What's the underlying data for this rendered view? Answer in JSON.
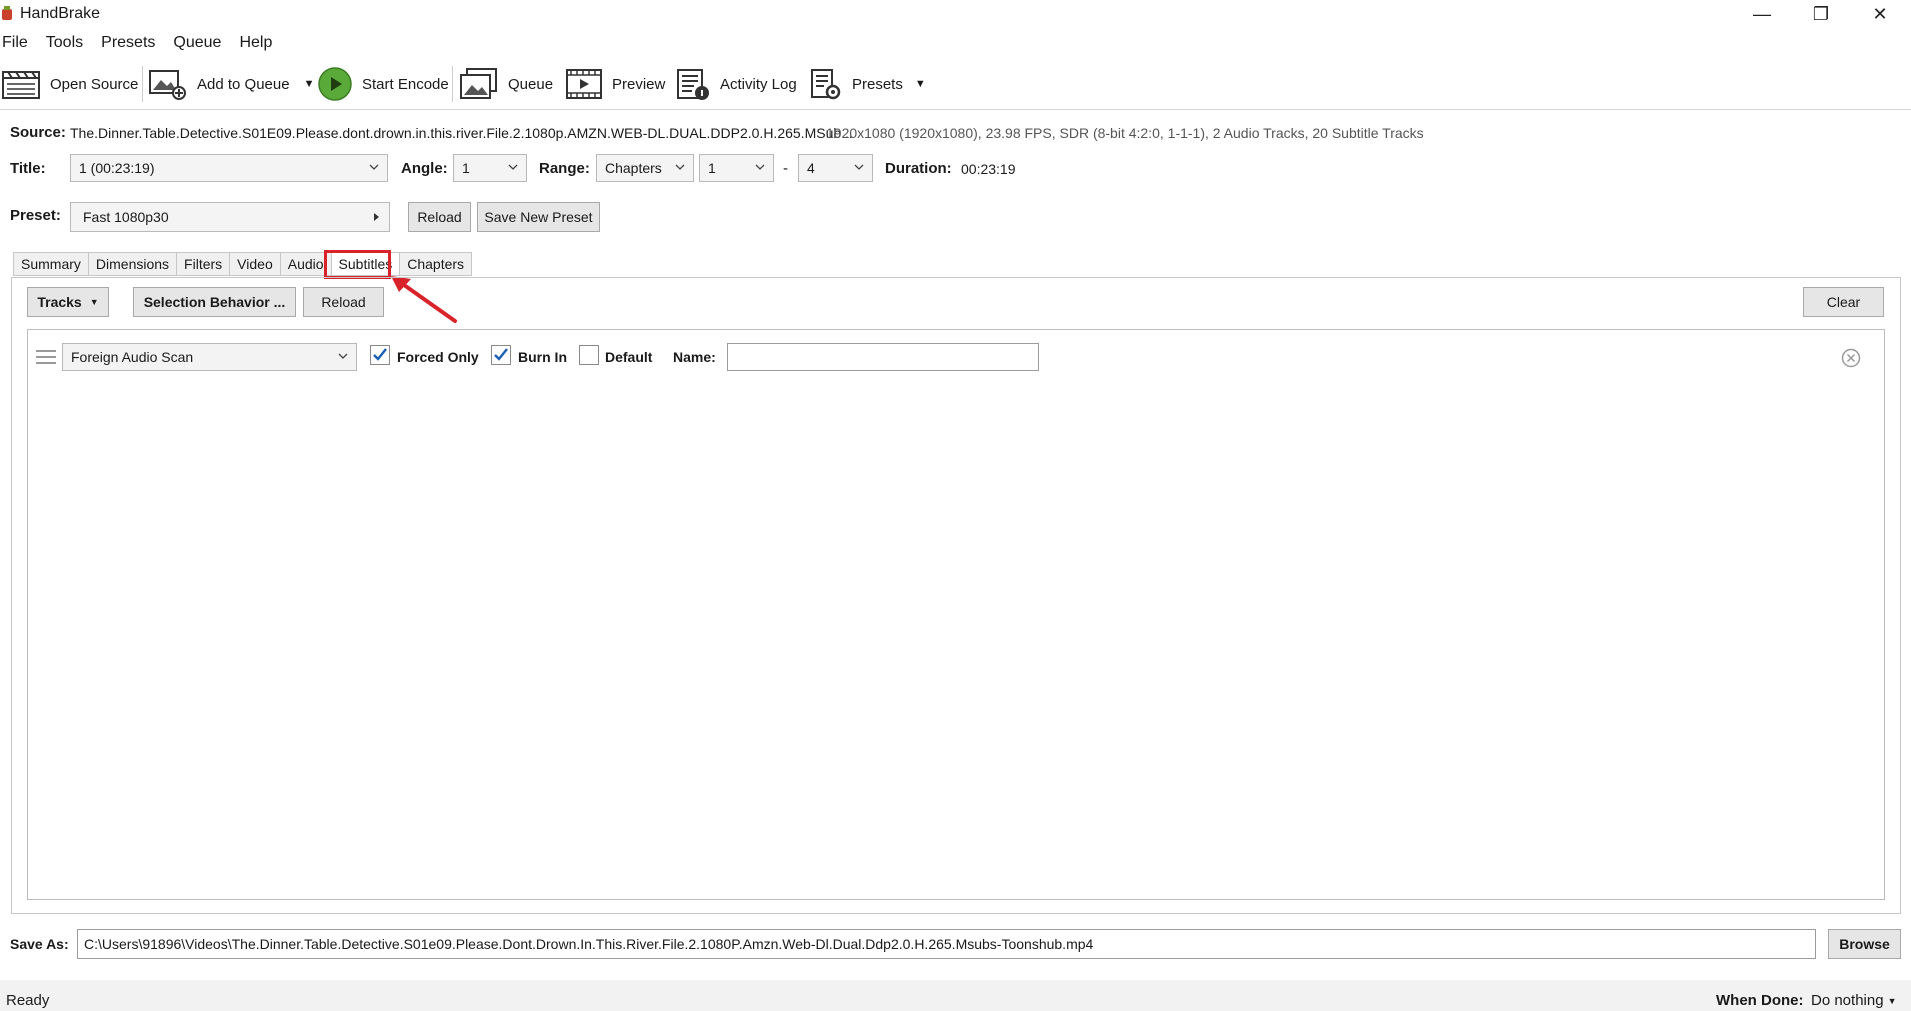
{
  "window": {
    "title": "HandBrake",
    "controls": {
      "minimize": "—",
      "restore": "❐",
      "close": "✕"
    }
  },
  "menu": [
    "File",
    "Tools",
    "Presets",
    "Queue",
    "Help"
  ],
  "toolbar": {
    "open_source": "Open Source",
    "add_to_queue": "Add to Queue",
    "start_encode": "Start Encode",
    "queue": "Queue",
    "preview": "Preview",
    "activity_log": "Activity Log",
    "presets": "Presets"
  },
  "source": {
    "label": "Source:",
    "filename": "The.Dinner.Table.Detective.S01E09.Please.dont.drown.in.this.river.File.2.1080p.AMZN.WEB-DL.DUAL.DDP2.0.H.265.MSub...",
    "info": "1920x1080 (1920x1080), 23.98 FPS, SDR (8-bit 4:2:0, 1-1-1), 2 Audio Tracks, 20 Subtitle Tracks"
  },
  "title_row": {
    "title_label": "Title:",
    "title_value": "1  (00:23:19)",
    "angle_label": "Angle:",
    "angle_value": "1",
    "range_label": "Range:",
    "range_type": "Chapters",
    "range_start": "1",
    "range_dash": "-",
    "range_end": "4",
    "duration_label": "Duration:",
    "duration_value": "00:23:19"
  },
  "preset_row": {
    "label": "Preset:",
    "value": "Fast 1080p30",
    "reload": "Reload",
    "save_new": "Save New Preset"
  },
  "tabs": [
    "Summary",
    "Dimensions",
    "Filters",
    "Video",
    "Audio",
    "Subtitles",
    "Chapters"
  ],
  "active_tab": "Subtitles",
  "subtitles": {
    "tracks_btn": "Tracks",
    "selection_behavior_btn": "Selection Behavior ...",
    "reload_btn": "Reload",
    "clear_btn": "Clear",
    "track": {
      "source": "Foreign Audio Scan",
      "forced_only_label": "Forced Only",
      "forced_only_checked": true,
      "burn_in_label": "Burn In",
      "burn_in_checked": true,
      "default_label": "Default",
      "default_checked": false,
      "name_label": "Name:",
      "name_value": ""
    }
  },
  "save_as": {
    "label": "Save As:",
    "path": "C:\\Users\\91896\\Videos\\The.Dinner.Table.Detective.S01e09.Please.Dont.Drown.In.This.River.File.2.1080P.Amzn.Web-Dl.Dual.Ddp2.0.H.265.Msubs-Toonshub.mp4",
    "browse": "Browse"
  },
  "status": {
    "text": "Ready",
    "when_done_label": "When Done:",
    "when_done_value": "Do nothing"
  },
  "colors": {
    "highlight": "#d9232a",
    "play_green": "#4caf50"
  }
}
